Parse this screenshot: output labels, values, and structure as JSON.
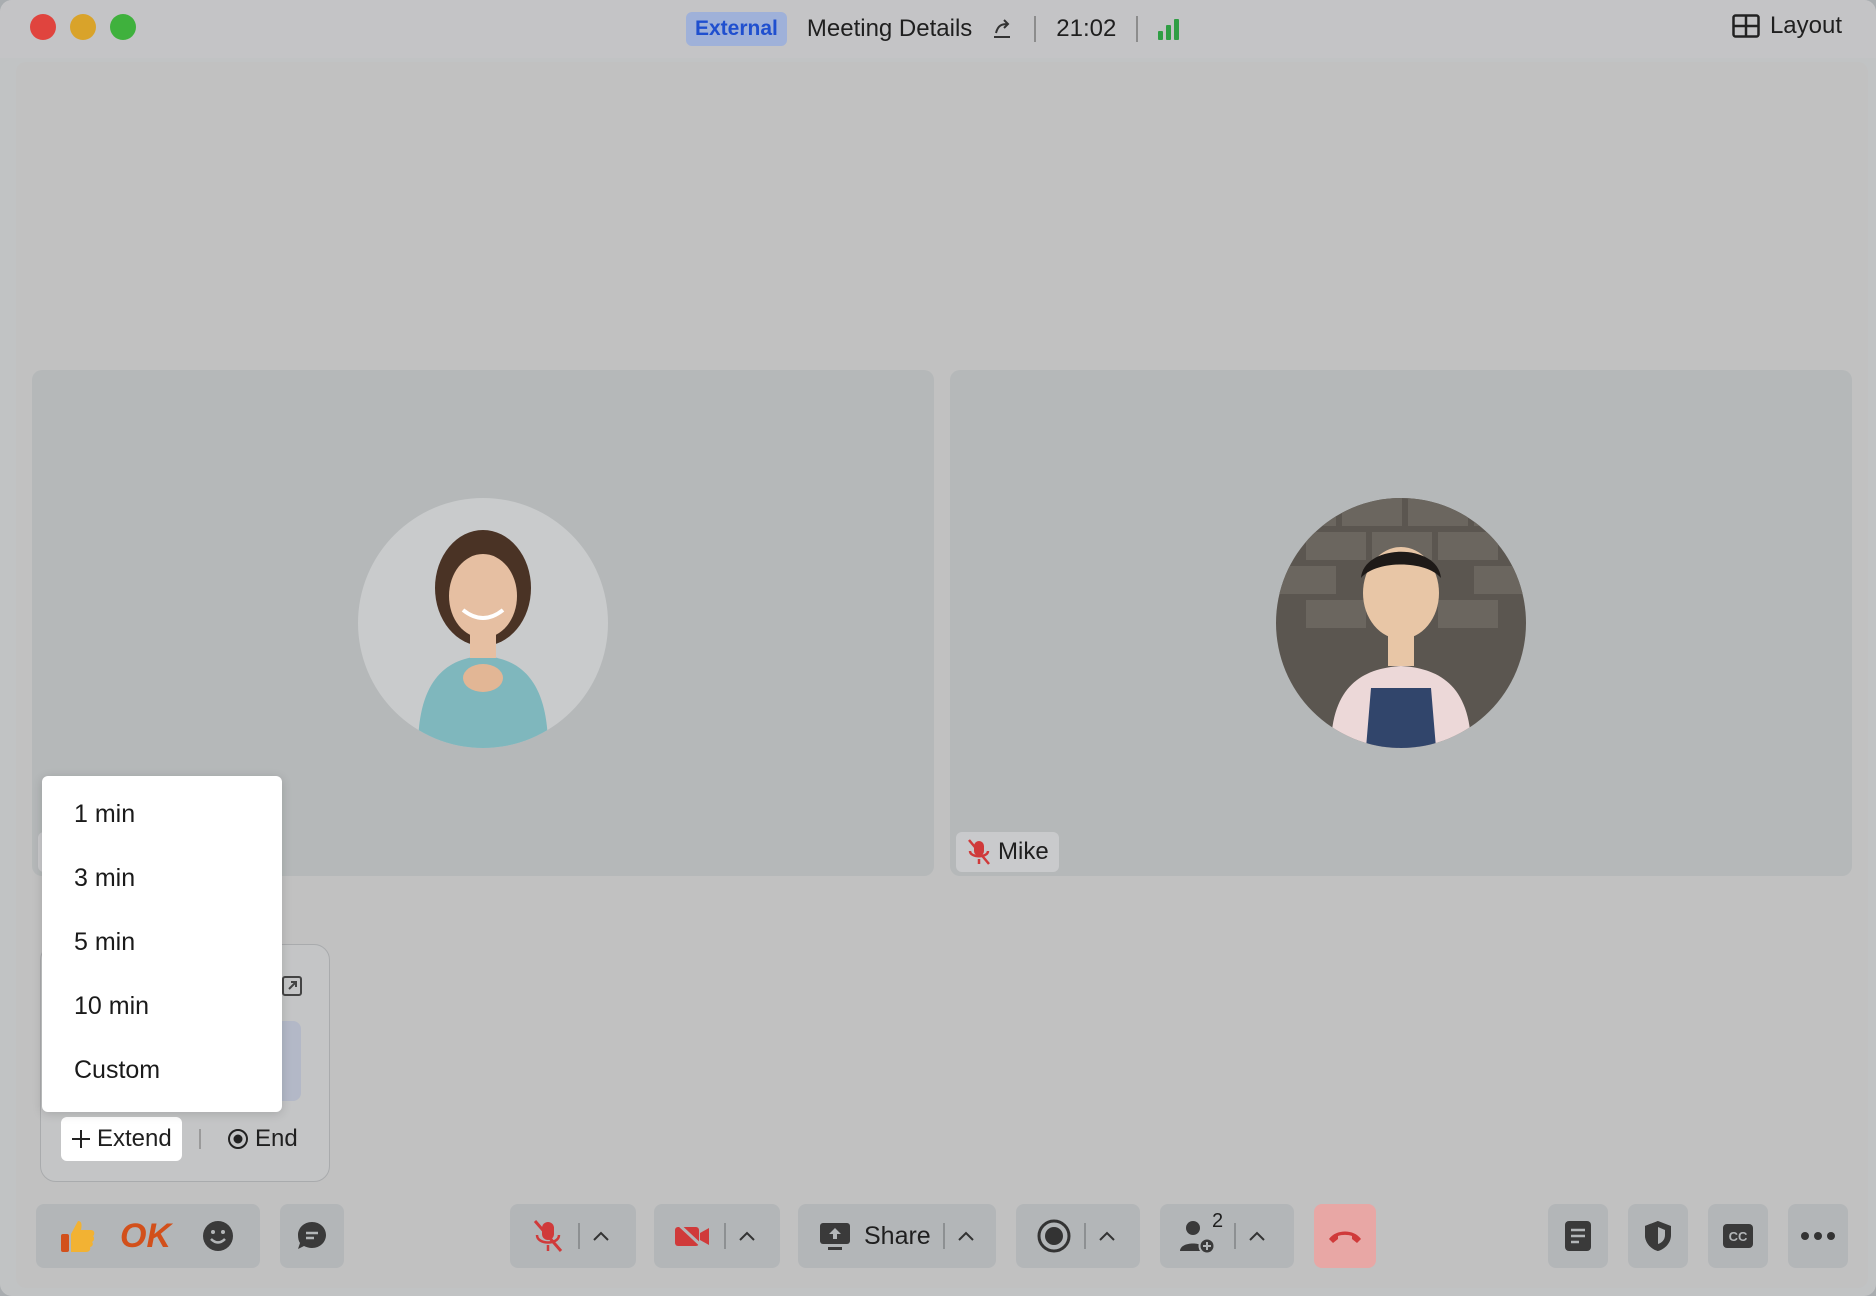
{
  "titlebar": {
    "external_badge": "External",
    "meeting_title": "Meeting Details",
    "clock": "21:02",
    "layout_label": "Layout"
  },
  "participants": [
    {
      "name": "",
      "muted": true
    },
    {
      "name": "Mike",
      "muted": true
    }
  ],
  "timer_card": {
    "extend_label": "Extend",
    "end_label": "End"
  },
  "extend_menu": {
    "options": [
      "1 min",
      "3 min",
      "5 min",
      "10 min",
      "Custom"
    ]
  },
  "toolbar": {
    "reaction_ok": "OK",
    "share_label": "Share",
    "participants_count": "2"
  },
  "colors": {
    "accent_blue": "#1f4fcf",
    "mute_red": "#d03a3a",
    "hangup_bg": "#e8a7a5",
    "signal_green": "#2f9e44"
  }
}
